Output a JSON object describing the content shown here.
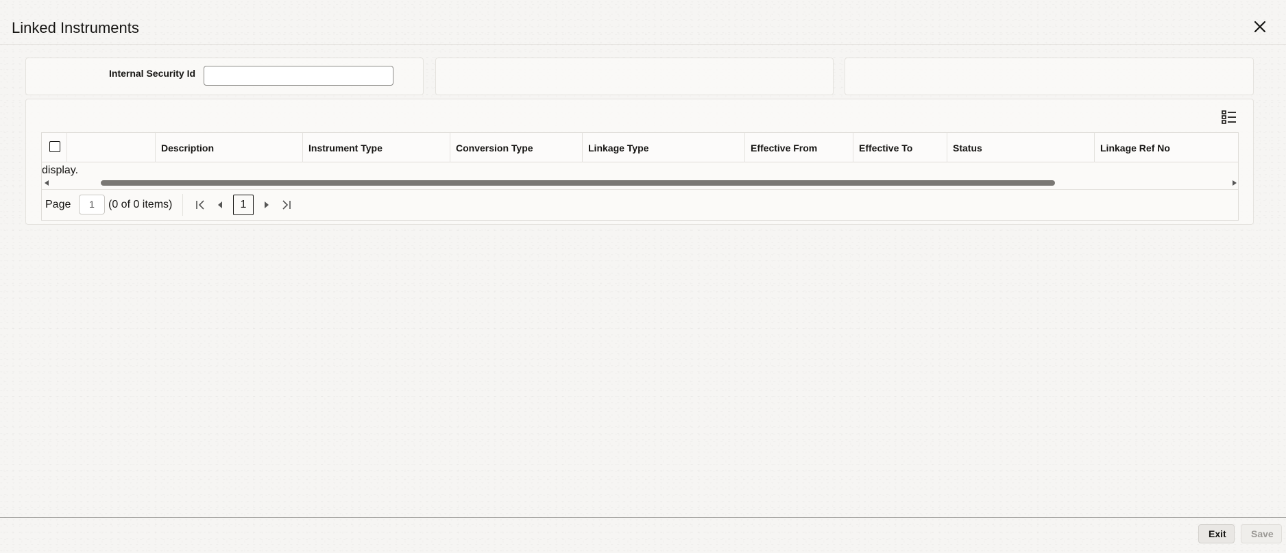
{
  "header": {
    "title": "Linked Instruments"
  },
  "form": {
    "internal_security_id_label": "Internal Security Id",
    "internal_security_id_value": ""
  },
  "grid": {
    "columns": [
      {
        "label": ""
      },
      {
        "label": "Description"
      },
      {
        "label": "Instrument Type"
      },
      {
        "label": "Conversion Type"
      },
      {
        "label": "Linkage Type"
      },
      {
        "label": "Effective From"
      },
      {
        "label": "Effective To"
      },
      {
        "label": "Status"
      },
      {
        "label": "Linkage Ref No"
      }
    ],
    "no_data_text": "display."
  },
  "pager": {
    "page_label": "Page",
    "page_value": "1",
    "count_text": "(0 of 0 items)",
    "current_page": "1"
  },
  "footer": {
    "exit_label": "Exit",
    "save_label": "Save"
  }
}
